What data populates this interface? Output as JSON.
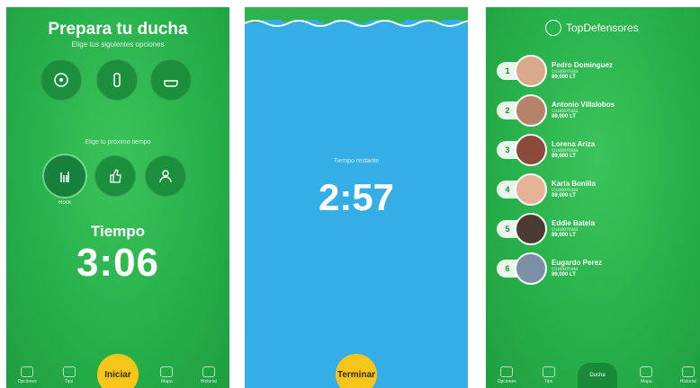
{
  "screen1": {
    "title": "Prepara tu ducha",
    "subtitle": "Elige tus siguientes opciones",
    "options_row1": [
      "",
      "",
      ""
    ],
    "section2_label": "Elige tu próximo tiempo",
    "options_row2": [
      "Rock",
      "",
      ""
    ],
    "tiempo_label": "Tiempo",
    "tiempo_value": "3:06",
    "nav": [
      "Opciones",
      "Tips",
      "",
      "Mapa",
      "Historial"
    ],
    "start_button": "Iniciar"
  },
  "screen2": {
    "remaining_label": "Tiempo restante",
    "remaining_value": "2:57",
    "end_button": "Terminar"
  },
  "screen3": {
    "header_title": "TopDefensores",
    "ranking": [
      {
        "rank": "1",
        "name": "Pedro Dominguez",
        "country": "Guatemala",
        "liters": "89,000 LT",
        "color": "#d9a98b"
      },
      {
        "rank": "2",
        "name": "Antonio Villalobos",
        "country": "Guatemala",
        "liters": "89,000 LT",
        "color": "#b6826a"
      },
      {
        "rank": "3",
        "name": "Lorena Ariza",
        "country": "Guatemala",
        "liters": "89,000 LT",
        "color": "#8a4b3a"
      },
      {
        "rank": "4",
        "name": "Karla Bonilla",
        "country": "Guatemala",
        "liters": "89,000 LT",
        "color": "#e6b295"
      },
      {
        "rank": "5",
        "name": "Eddie Batela",
        "country": "Guatemala",
        "liters": "89,000 LT",
        "color": "#4b3a32"
      },
      {
        "rank": "6",
        "name": "Eugardo Perez",
        "country": "Guatemala",
        "liters": "89,000 LT",
        "color": "#7d8fa6"
      }
    ],
    "nav": [
      "Opciones",
      "Tips",
      "",
      "Mapa",
      "Historial"
    ],
    "center_nav": "Ducha"
  },
  "colors": {
    "green": "#27b14a",
    "blue": "#35aee8",
    "yellow": "#f8c51b"
  }
}
